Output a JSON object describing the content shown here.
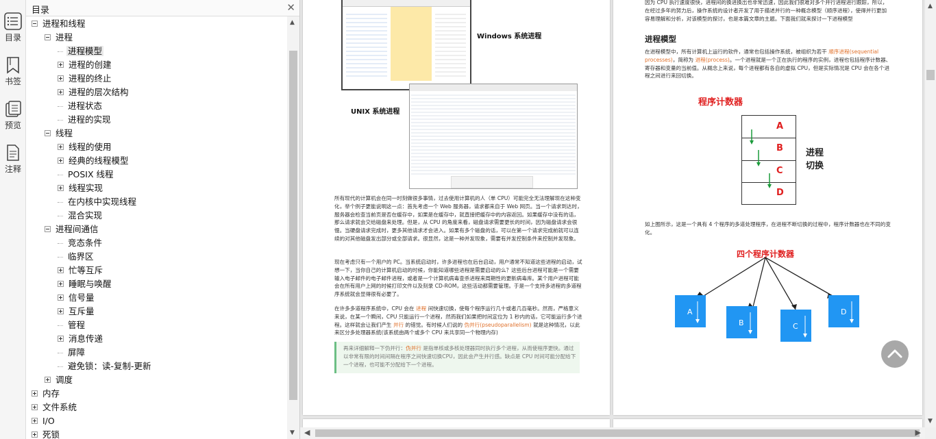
{
  "rail": {
    "items": [
      {
        "label": "目录",
        "icon": "toc-icon"
      },
      {
        "label": "书签",
        "icon": "bookmark-icon"
      },
      {
        "label": "预览",
        "icon": "preview-icon"
      },
      {
        "label": "注释",
        "icon": "annotation-icon"
      }
    ]
  },
  "toc": {
    "title": "目录",
    "close_icon": "close-icon",
    "items": [
      {
        "label": "进程和线程",
        "level": 0,
        "exp": "minus"
      },
      {
        "label": "进程",
        "level": 1,
        "exp": "minus"
      },
      {
        "label": "进程模型",
        "level": 2,
        "exp": "none",
        "selected": true
      },
      {
        "label": "进程的创建",
        "level": 2,
        "exp": "plus"
      },
      {
        "label": "进程的终止",
        "level": 2,
        "exp": "plus"
      },
      {
        "label": "进程的层次结构",
        "level": 2,
        "exp": "plus"
      },
      {
        "label": "进程状态",
        "level": 2,
        "exp": "none"
      },
      {
        "label": "进程的实现",
        "level": 2,
        "exp": "none"
      },
      {
        "label": "线程",
        "level": 1,
        "exp": "minus"
      },
      {
        "label": "线程的使用",
        "level": 2,
        "exp": "plus"
      },
      {
        "label": "经典的线程模型",
        "level": 2,
        "exp": "plus"
      },
      {
        "label": "POSIX 线程",
        "level": 2,
        "exp": "none"
      },
      {
        "label": "线程实现",
        "level": 2,
        "exp": "plus"
      },
      {
        "label": "在内核中实现线程",
        "level": 2,
        "exp": "none"
      },
      {
        "label": "混合实现",
        "level": 2,
        "exp": "none"
      },
      {
        "label": "进程间通信",
        "level": 1,
        "exp": "minus"
      },
      {
        "label": "竞态条件",
        "level": 2,
        "exp": "none"
      },
      {
        "label": "临界区",
        "level": 2,
        "exp": "none"
      },
      {
        "label": "忙等互斥",
        "level": 2,
        "exp": "plus"
      },
      {
        "label": "睡眠与唤醒",
        "level": 2,
        "exp": "plus"
      },
      {
        "label": "信号量",
        "level": 2,
        "exp": "plus"
      },
      {
        "label": "互斥量",
        "level": 2,
        "exp": "plus"
      },
      {
        "label": "管程",
        "level": 2,
        "exp": "none"
      },
      {
        "label": "消息传递",
        "level": 2,
        "exp": "plus"
      },
      {
        "label": "屏障",
        "level": 2,
        "exp": "none"
      },
      {
        "label": "避免锁：读-复制-更新",
        "level": 2,
        "exp": "none"
      },
      {
        "label": "调度",
        "level": 1,
        "exp": "plus"
      },
      {
        "label": "内存",
        "level": 0,
        "exp": "plus"
      },
      {
        "label": "文件系统",
        "level": 0,
        "exp": "plus"
      },
      {
        "label": "I/O",
        "level": 0,
        "exp": "plus"
      },
      {
        "label": "死锁",
        "level": 0,
        "exp": "plus"
      }
    ]
  },
  "page_left": {
    "windows_caption": "Windows 系统进程",
    "unix_caption": "UNIX 系统进程",
    "para1": "所有现代的计算机会在同一时刻做很多事情，过去使用计算机的人（单 CPU）可能完全无法理解现在这种变化，举个例子更能说明这一点：首先考虑一个 Web 服务器，请求都来自于 Web 网页。当一个请求到达时，服务器会检查当前页是否在缓存中，如果是在缓存中，就直接把缓存中的内容返回。如果缓存中没有的话，那么请求就会交给磁盘来处理。但是，从 CPU 的角度来看，磁盘请求需要更长的时间，因为磁盘请求会很慢。当硬盘请求完成时，更多其他请求才会进入。如果有多个磁盘的话，可以在第一个请求完成前就可以连续的对其他磁盘发出部分或全部请求。很显然，这是一种并发现象，需要有并发控制条件来控制并发现象。",
    "para2": "现在考虑只有一个用户的 PC。当系统启动时，许多进程也在后台启动，用户通常不知道这些进程的启动，试想一下，当你自己的计算机启动的时候，你能知道哪些进程是需要启动的么？这些后台进程可能是一个需要输入电子邮件的电子邮件进程，或者是一个计算机病毒查杀进程来周期性的更新病毒库。某个用户进程可能会在所有用户上网的时候打印文件以及刻录 CD-ROM，这些活动都需要管理。于是一个支持多进程的多道程序系统就会显得很有必要了。",
    "para3a": "在许多多道程序系统中，CPU 会在 ",
    "para3_hl1": "进程",
    "para3b": " 间快速切换，使每个程序运行几十或者几百毫秒。然而，严格意义来说，在某一个瞬间，CPU 只能运行一个进程，然而我们如果把时间定位为 1 秒内的话，它可能运行多个进程。这样就会让我们产生 ",
    "para3_hl2": "并行",
    "para3c": " 的错觉。有时候人们说的 ",
    "para3_hl3": "伪并行(pseudoparallelism)",
    "para3d": " 就是这种情况，以此来区分多处理器系统(该系统由两个或多个 CPU 来共享同一个物理内存)",
    "callout_a": "再来详细解释一下伪并行：",
    "callout_hl": "伪并行",
    "callout_b": " 是指单核或多核处理器同时执行多个进程，从而使程序更快。通过以非常有限的时间间隔在程序之间快速切换CPU，因此会产生并行感。缺点是 CPU 时间可能分配给下一个进程，也可能不分配给下一个进程。"
  },
  "page_right": {
    "intro": "因为 CPU 执行速度很快，进程间的换进换出也非常迅速，因此我们很难对多个并行进程进行跟踪，所以，在经过多年的努力后，操作系统的设计者开发了用于描述并行的一种概念模型（顺序进程），使得并行更加容易理解和分析，对该模型的探讨，也是本篇文章的主题。下面我们就来探讨一下进程模型",
    "section_title": "进程模型",
    "model_a": "在进程模型中，所有计算机上运行的软件，通常也包括操作系统，被组织为若干 ",
    "model_hl1": "顺序进程(sequential processes)",
    "model_b": "，简称为 ",
    "model_hl2": "进程(process)",
    "model_c": "。一个进程就是一个正在执行的程序的实例，进程也包括程序计数器、寄存器和变量的当前值。从概念上来说，每个进程都有各自的虚拟 CPU，但是实际情况是 CPU 会在各个进程之间进行来回切换。",
    "diagram1_title": "程序计数器",
    "diagram1_cells": [
      "A",
      "B",
      "C",
      "D"
    ],
    "diagram1_label": "进程切换",
    "desc": "如上图所示，这是一个具有 4 个程序的多道处理程序，在进程不断切换的过程中，程序计数器也在不同的变化。",
    "diagram2_title": "四个程序计数器",
    "diagram2_boxes": [
      "A",
      "B",
      "C",
      "D"
    ]
  },
  "colors": {
    "accent_red": "#e02020",
    "box_blue": "#2196f3",
    "highlight_orange": "#e0702a",
    "callout_green": "#6cbf84"
  }
}
